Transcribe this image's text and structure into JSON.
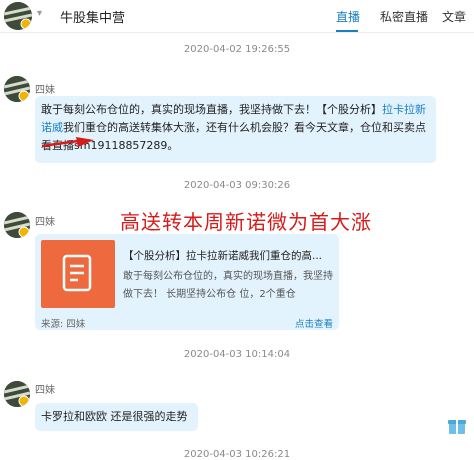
{
  "header": {
    "title": "牛股集中营",
    "caret": "▾",
    "tabs": [
      {
        "label": "直播",
        "active": true
      },
      {
        "label": "私密直播",
        "active": false
      },
      {
        "label": "文章",
        "active": false
      }
    ]
  },
  "overlay_text": "高送转本周新诺微为首大涨",
  "feed": [
    {
      "timestamp": "2020-04-02 19:26:55"
    },
    {
      "author": "四妹",
      "text_before": "敢于每刻公布仓位的，真实的现场直播，我坚持做下去！【个股分析】",
      "text_link": "拉卡拉新诺威",
      "text_after": "我们重仓的高送转集体大涨，还有什么机会股？看今天文章，仓位和买卖点看直播sm19118857289。"
    },
    {
      "timestamp": "2020-04-03 09:30:26"
    },
    {
      "author": "四妹",
      "card": {
        "title": "【个股分析】拉卡拉新诺威我们重仓的高...",
        "desc": "敢于每刻公布仓位的，真实的现场直播，我坚持做下去！ 长期坚持公布仓 位，2个重仓",
        "source": "来源:  四妹",
        "link": "点击查看"
      }
    },
    {
      "timestamp": "2020-04-03 10:14:04"
    },
    {
      "author": "四妹",
      "text": "卡罗拉和欧欧 还是很强的走势"
    },
    {
      "timestamp": "2020-04-03 10:26:21"
    }
  ],
  "colors": {
    "accent": "#1a7fc4",
    "bubble": "#e3f3fd",
    "overlay": "#d71a1a",
    "card_thumb": "#ee6a3e"
  },
  "icons": [
    "avatar",
    "chevron-down-icon",
    "document-icon",
    "red-arrow-annotation",
    "gift-icon"
  ]
}
